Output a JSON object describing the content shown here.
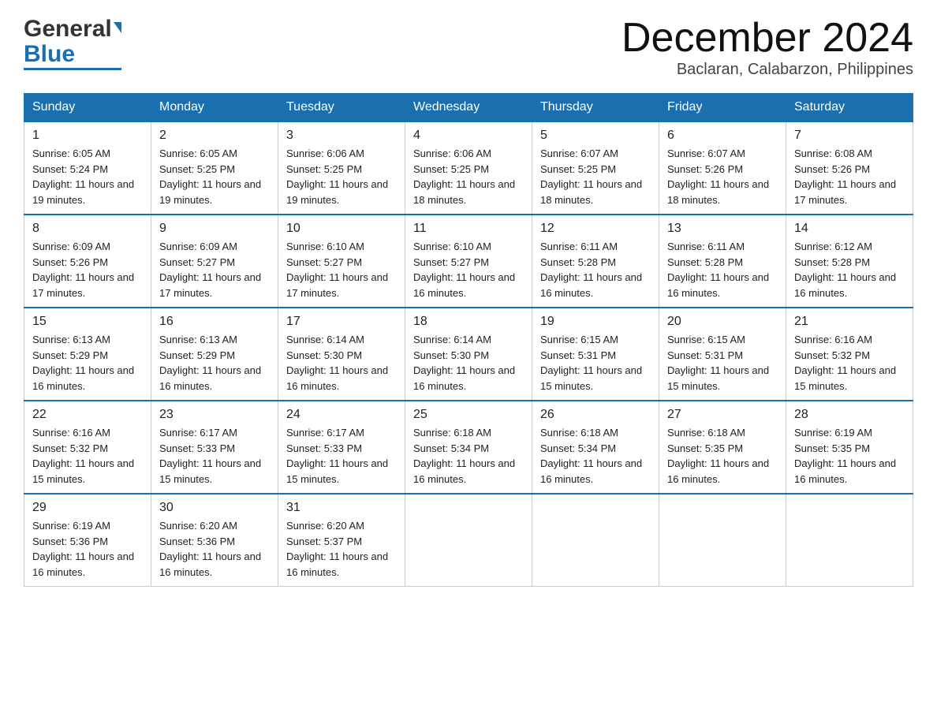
{
  "header": {
    "logo_general": "General",
    "logo_blue": "Blue",
    "month_title": "December 2024",
    "location": "Baclaran, Calabarzon, Philippines"
  },
  "days_of_week": [
    "Sunday",
    "Monday",
    "Tuesday",
    "Wednesday",
    "Thursday",
    "Friday",
    "Saturday"
  ],
  "weeks": [
    [
      {
        "day": "1",
        "sunrise": "6:05 AM",
        "sunset": "5:24 PM",
        "daylight": "11 hours and 19 minutes."
      },
      {
        "day": "2",
        "sunrise": "6:05 AM",
        "sunset": "5:25 PM",
        "daylight": "11 hours and 19 minutes."
      },
      {
        "day": "3",
        "sunrise": "6:06 AM",
        "sunset": "5:25 PM",
        "daylight": "11 hours and 19 minutes."
      },
      {
        "day": "4",
        "sunrise": "6:06 AM",
        "sunset": "5:25 PM",
        "daylight": "11 hours and 18 minutes."
      },
      {
        "day": "5",
        "sunrise": "6:07 AM",
        "sunset": "5:25 PM",
        "daylight": "11 hours and 18 minutes."
      },
      {
        "day": "6",
        "sunrise": "6:07 AM",
        "sunset": "5:26 PM",
        "daylight": "11 hours and 18 minutes."
      },
      {
        "day": "7",
        "sunrise": "6:08 AM",
        "sunset": "5:26 PM",
        "daylight": "11 hours and 17 minutes."
      }
    ],
    [
      {
        "day": "8",
        "sunrise": "6:09 AM",
        "sunset": "5:26 PM",
        "daylight": "11 hours and 17 minutes."
      },
      {
        "day": "9",
        "sunrise": "6:09 AM",
        "sunset": "5:27 PM",
        "daylight": "11 hours and 17 minutes."
      },
      {
        "day": "10",
        "sunrise": "6:10 AM",
        "sunset": "5:27 PM",
        "daylight": "11 hours and 17 minutes."
      },
      {
        "day": "11",
        "sunrise": "6:10 AM",
        "sunset": "5:27 PM",
        "daylight": "11 hours and 16 minutes."
      },
      {
        "day": "12",
        "sunrise": "6:11 AM",
        "sunset": "5:28 PM",
        "daylight": "11 hours and 16 minutes."
      },
      {
        "day": "13",
        "sunrise": "6:11 AM",
        "sunset": "5:28 PM",
        "daylight": "11 hours and 16 minutes."
      },
      {
        "day": "14",
        "sunrise": "6:12 AM",
        "sunset": "5:28 PM",
        "daylight": "11 hours and 16 minutes."
      }
    ],
    [
      {
        "day": "15",
        "sunrise": "6:13 AM",
        "sunset": "5:29 PM",
        "daylight": "11 hours and 16 minutes."
      },
      {
        "day": "16",
        "sunrise": "6:13 AM",
        "sunset": "5:29 PM",
        "daylight": "11 hours and 16 minutes."
      },
      {
        "day": "17",
        "sunrise": "6:14 AM",
        "sunset": "5:30 PM",
        "daylight": "11 hours and 16 minutes."
      },
      {
        "day": "18",
        "sunrise": "6:14 AM",
        "sunset": "5:30 PM",
        "daylight": "11 hours and 16 minutes."
      },
      {
        "day": "19",
        "sunrise": "6:15 AM",
        "sunset": "5:31 PM",
        "daylight": "11 hours and 15 minutes."
      },
      {
        "day": "20",
        "sunrise": "6:15 AM",
        "sunset": "5:31 PM",
        "daylight": "11 hours and 15 minutes."
      },
      {
        "day": "21",
        "sunrise": "6:16 AM",
        "sunset": "5:32 PM",
        "daylight": "11 hours and 15 minutes."
      }
    ],
    [
      {
        "day": "22",
        "sunrise": "6:16 AM",
        "sunset": "5:32 PM",
        "daylight": "11 hours and 15 minutes."
      },
      {
        "day": "23",
        "sunrise": "6:17 AM",
        "sunset": "5:33 PM",
        "daylight": "11 hours and 15 minutes."
      },
      {
        "day": "24",
        "sunrise": "6:17 AM",
        "sunset": "5:33 PM",
        "daylight": "11 hours and 15 minutes."
      },
      {
        "day": "25",
        "sunrise": "6:18 AM",
        "sunset": "5:34 PM",
        "daylight": "11 hours and 16 minutes."
      },
      {
        "day": "26",
        "sunrise": "6:18 AM",
        "sunset": "5:34 PM",
        "daylight": "11 hours and 16 minutes."
      },
      {
        "day": "27",
        "sunrise": "6:18 AM",
        "sunset": "5:35 PM",
        "daylight": "11 hours and 16 minutes."
      },
      {
        "day": "28",
        "sunrise": "6:19 AM",
        "sunset": "5:35 PM",
        "daylight": "11 hours and 16 minutes."
      }
    ],
    [
      {
        "day": "29",
        "sunrise": "6:19 AM",
        "sunset": "5:36 PM",
        "daylight": "11 hours and 16 minutes."
      },
      {
        "day": "30",
        "sunrise": "6:20 AM",
        "sunset": "5:36 PM",
        "daylight": "11 hours and 16 minutes."
      },
      {
        "day": "31",
        "sunrise": "6:20 AM",
        "sunset": "5:37 PM",
        "daylight": "11 hours and 16 minutes."
      },
      null,
      null,
      null,
      null
    ]
  ]
}
